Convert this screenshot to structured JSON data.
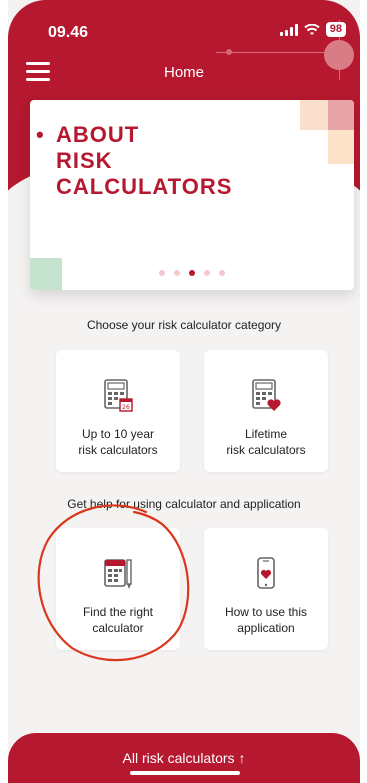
{
  "status": {
    "time": "09.46",
    "battery": "98"
  },
  "header": {
    "title": "Home"
  },
  "banner": {
    "title_lines": [
      "ABOUT",
      "RISK",
      "CALCULATORS"
    ],
    "slides_total": 5,
    "slides_active": 3
  },
  "categories": {
    "label": "Choose your risk calculator category",
    "items": [
      {
        "line1": "Up to 10 year",
        "line2": "risk calculators"
      },
      {
        "line1": "Lifetime",
        "line2": "risk calculators"
      }
    ]
  },
  "help": {
    "label": "Get help for using calculator and application",
    "items": [
      {
        "line1": "Find the right",
        "line2": "calculator"
      },
      {
        "line1": "How to use this",
        "line2": "application"
      }
    ]
  },
  "bottom": {
    "label": "All risk calculators ↑"
  },
  "colors": {
    "brand": "#b5182f",
    "background": "#f5f3f2",
    "annotation": "#d9381e"
  }
}
